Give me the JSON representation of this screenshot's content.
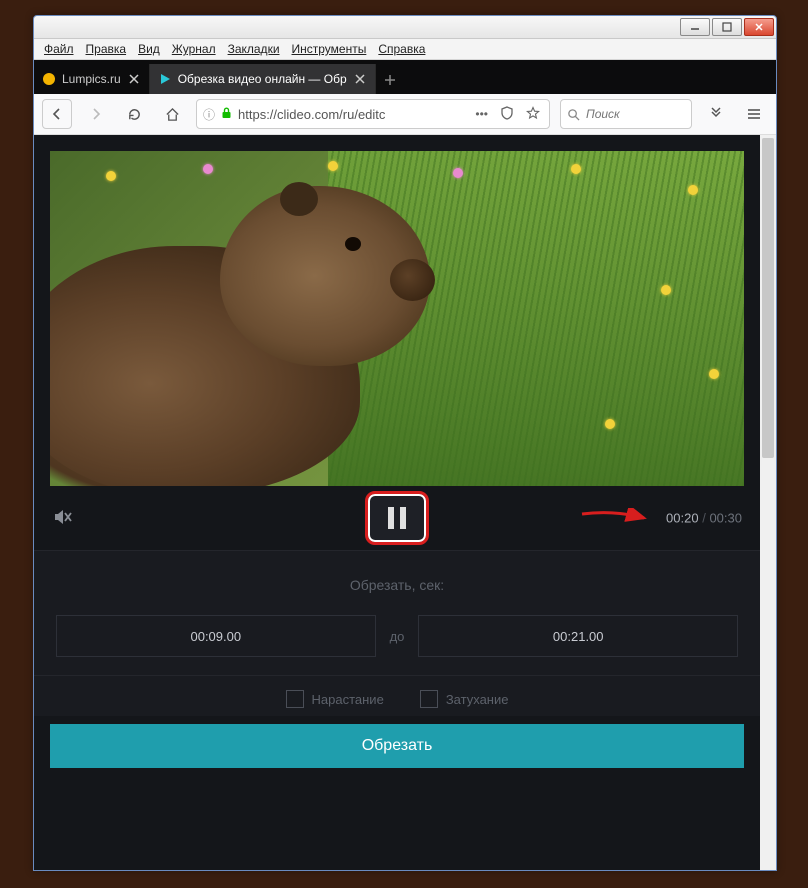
{
  "menu": {
    "file": "Файл",
    "edit": "Правка",
    "view": "Вид",
    "history": "Журнал",
    "bookmarks": "Закладки",
    "tools": "Инструменты",
    "help": "Справка"
  },
  "tabs": [
    {
      "label": "Lumpics.ru"
    },
    {
      "label": "Обрезка видео онлайн — Обр"
    }
  ],
  "address": {
    "url": "https://clideo.com/ru/editc",
    "search_placeholder": "Поиск"
  },
  "player": {
    "current_time": "00:20",
    "total_time": "00:30"
  },
  "trim": {
    "section_label": "Обрезать, сек:",
    "from_value": "00:09.00",
    "to_label": "до",
    "to_value": "00:21.00"
  },
  "fade": {
    "fade_in": "Нарастание",
    "fade_out": "Затухание"
  },
  "buttons": {
    "cut": "Обрезать"
  }
}
